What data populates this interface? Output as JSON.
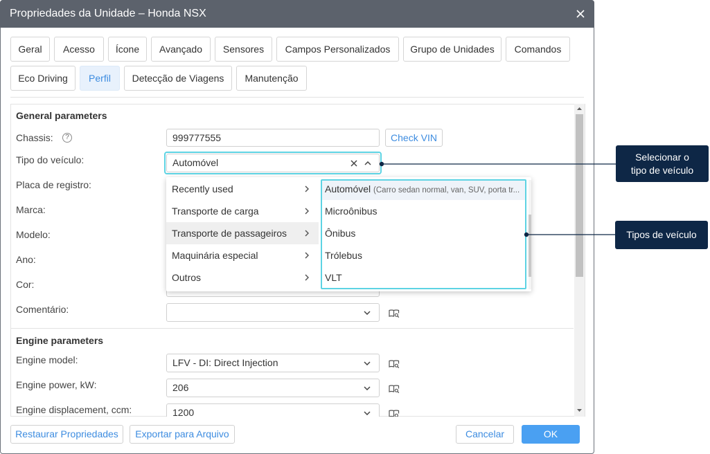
{
  "window": {
    "title": "Propriedades da Unidade – Honda NSX"
  },
  "tabs": {
    "row1": [
      {
        "label": "Geral"
      },
      {
        "label": "Acesso"
      },
      {
        "label": "Ícone"
      },
      {
        "label": "Avançado"
      },
      {
        "label": "Sensores"
      },
      {
        "label": "Campos Personalizados"
      },
      {
        "label": "Grupo de Unidades"
      },
      {
        "label": "Comandos"
      }
    ],
    "row2": [
      {
        "label": "Eco Driving"
      },
      {
        "label": "Perfil",
        "active": true
      },
      {
        "label": "Detecção de Viagens"
      },
      {
        "label": "Manutenção"
      }
    ]
  },
  "general": {
    "title": "General parameters",
    "chassis": {
      "label": "Chassis:",
      "help": "?",
      "value": "999777555",
      "check_button": "Check VIN"
    },
    "vehicle_type": {
      "label": "Tipo do veículo:",
      "value": "Automóvel"
    },
    "plate": {
      "label": "Placa de registro:"
    },
    "brand": {
      "label": "Marca:"
    },
    "model": {
      "label": "Modelo:"
    },
    "year": {
      "label": "Ano:"
    },
    "color": {
      "label": "Cor:"
    },
    "comment": {
      "label": "Comentário:",
      "value": ""
    }
  },
  "engine": {
    "title": "Engine parameters",
    "model": {
      "label": "Engine model:",
      "value": "LFV - DI: Direct Injection"
    },
    "power": {
      "label": "Engine power, kW:",
      "value": "206"
    },
    "displacement": {
      "label": "Engine displacement, ccm:",
      "value": "1200"
    }
  },
  "vehicle_dropdown": {
    "categories": [
      {
        "label": "Recently used"
      },
      {
        "label": "Transporte de carga"
      },
      {
        "label": "Transporte de passageiros",
        "highlighted": true
      },
      {
        "label": "Maquinária especial"
      },
      {
        "label": "Outros"
      }
    ],
    "types": [
      {
        "name": "Automóvel",
        "description": "(Carro sedan normal, van, SUV, porta tr...",
        "selected": true
      },
      {
        "name": "Microônibus"
      },
      {
        "name": "Ônibus"
      },
      {
        "name": "Trólebus"
      },
      {
        "name": "VLT"
      }
    ]
  },
  "footer": {
    "restore": "Restaurar Propriedades",
    "export": "Exportar para Arquivo",
    "cancel": "Cancelar",
    "ok": "OK"
  },
  "callouts": {
    "select_type": [
      "Selecionar o",
      "tipo de veículo"
    ],
    "types": "Tipos de veículo"
  },
  "icons": {
    "close": "close-icon",
    "help": "help-circle-icon",
    "clear": "clear-icon",
    "expand": "chevron-down-icon",
    "collapse": "chevron-up-icon",
    "submenu": "chevron-right-icon",
    "dictionary": "book-search-icon"
  },
  "colors": {
    "title_bar": "#5c626c",
    "accent_text": "#3d8ce0",
    "primary_button": "#4aa0f2",
    "annotation_highlight": "#5dd3e3",
    "callout_background": "#0e2746"
  }
}
